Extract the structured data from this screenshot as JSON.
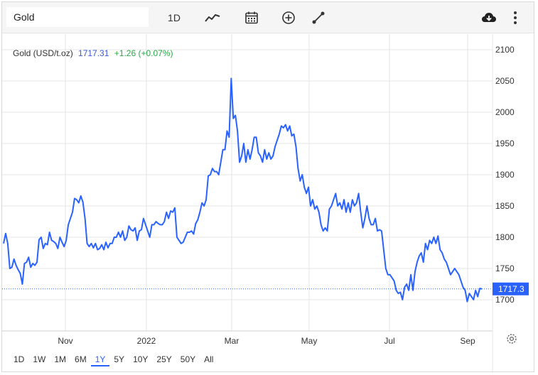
{
  "toolbar": {
    "symbol_value": "Gold",
    "interval_label": "1D",
    "icons": [
      "line-chart-icon",
      "calendar-icon",
      "plus-circle-icon",
      "draw-line-icon",
      "cloud-download-icon",
      "more-vertical-icon"
    ]
  },
  "legend": {
    "name": "Gold (USD/t.oz)",
    "price": "1717.31",
    "change": "+1.26 (+0.07%)",
    "price_color": "#3a5bd9",
    "change_color": "#27a844"
  },
  "price_tag": "1717.3",
  "colors": {
    "line": "#2962ff",
    "tag_bg": "#2962ff",
    "grid": "#e6e6e6"
  },
  "range_buttons": [
    "1D",
    "1W",
    "1M",
    "6M",
    "1Y",
    "5Y",
    "10Y",
    "25Y",
    "50Y",
    "All"
  ],
  "active_range": "1Y",
  "settings_icon": "gear-icon",
  "chart_data": {
    "type": "line",
    "title": "",
    "xlabel": "",
    "ylabel": "",
    "ylim": [
      1650,
      2125
    ],
    "y_ticks": [
      "1700",
      "1750",
      "1800",
      "1850",
      "1900",
      "1950",
      "2000",
      "2050",
      "2100"
    ],
    "x_ticks": [
      "Nov",
      "2022",
      "Mar",
      "May",
      "Jul",
      "Sep"
    ],
    "last_value": 1717.3,
    "grid": true,
    "series": [
      {
        "values": [
          1790,
          1806,
          1790,
          1750,
          1752,
          1765,
          1755,
          1748,
          1742,
          1725,
          1758,
          1760,
          1768,
          1752,
          1758,
          1755,
          1760,
          1796,
          1800,
          1782,
          1790,
          1788,
          1808,
          1795,
          1793,
          1790,
          1782,
          1800,
          1792,
          1785,
          1795,
          1820,
          1830,
          1840,
          1862,
          1860,
          1855,
          1866,
          1856,
          1830,
          1790,
          1785,
          1790,
          1783,
          1790,
          1780,
          1782,
          1788,
          1780,
          1792,
          1783,
          1790,
          1790,
          1800,
          1800,
          1808,
          1800,
          1810,
          1795,
          1800,
          1818,
          1812,
          1810,
          1815,
          1795,
          1810,
          1812,
          1830,
          1820,
          1810,
          1800,
          1820,
          1820,
          1825,
          1822,
          1820,
          1820,
          1825,
          1840,
          1830,
          1842,
          1840,
          1847,
          1800,
          1795,
          1790,
          1792,
          1800,
          1808,
          1808,
          1810,
          1805,
          1822,
          1828,
          1840,
          1855,
          1850,
          1860,
          1898,
          1900,
          1910,
          1905,
          1905,
          1900,
          1920,
          1940,
          1940,
          1970,
          1960,
          2054,
          1990,
          1995,
          1970,
          1920,
          1930,
          1950,
          1920,
          1940,
          1925,
          1940,
          1960,
          1960,
          1935,
          1930,
          1920,
          1940,
          1925,
          1935,
          1925,
          1930,
          1945,
          1955,
          1965,
          1978,
          1975,
          1980,
          1970,
          1978,
          1962,
          1965,
          1945,
          1910,
          1890,
          1900,
          1880,
          1870,
          1880,
          1850,
          1860,
          1845,
          1850,
          1840,
          1820,
          1810,
          1815,
          1810,
          1845,
          1850,
          1860,
          1870,
          1850,
          1855,
          1845,
          1860,
          1840,
          1855,
          1840,
          1860,
          1850,
          1855,
          1870,
          1840,
          1815,
          1830,
          1850,
          1830,
          1820,
          1820,
          1830,
          1810,
          1812,
          1810,
          1780,
          1750,
          1740,
          1740,
          1735,
          1730,
          1715,
          1710,
          1712,
          1700,
          1720,
          1725,
          1715,
          1740,
          1715,
          1745,
          1760,
          1770,
          1775,
          1760,
          1790,
          1780,
          1795,
          1790,
          1800,
          1790,
          1802,
          1780,
          1775,
          1765,
          1760,
          1750,
          1740,
          1745,
          1750,
          1745,
          1740,
          1730,
          1720,
          1715,
          1697,
          1710,
          1705,
          1700,
          1715,
          1705,
          1718,
          1717.3
        ]
      }
    ]
  }
}
